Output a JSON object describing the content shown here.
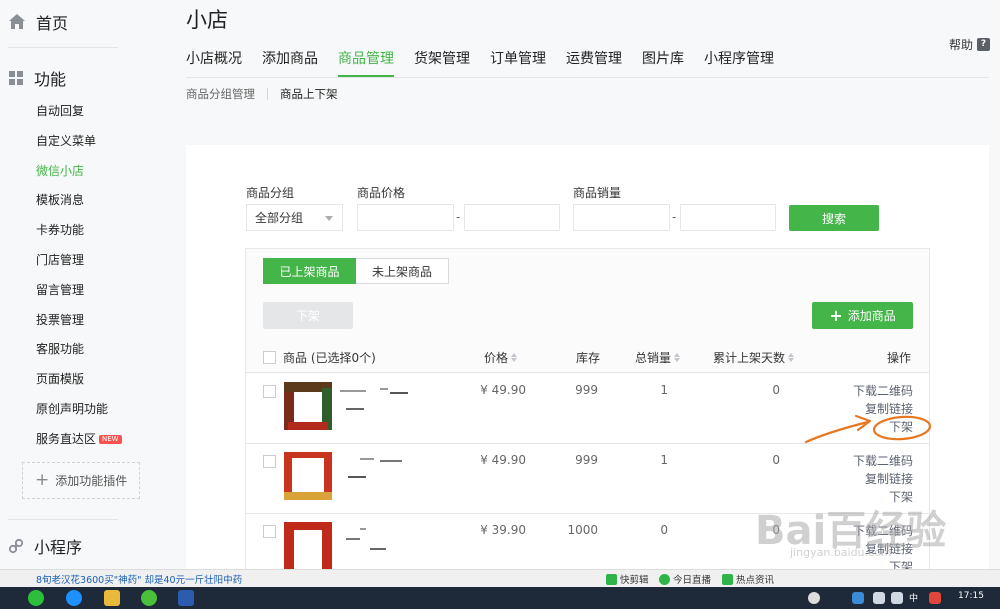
{
  "sidebar": {
    "home": "首页",
    "functions": "功能",
    "items": [
      {
        "label": "自动回复"
      },
      {
        "label": "自定义菜单"
      },
      {
        "label": "微信小店"
      },
      {
        "label": "模板消息"
      },
      {
        "label": "卡券功能"
      },
      {
        "label": "门店管理"
      },
      {
        "label": "留言管理"
      },
      {
        "label": "投票管理"
      },
      {
        "label": "客服功能"
      },
      {
        "label": "页面模版"
      },
      {
        "label": "原创声明功能"
      },
      {
        "label": "服务直达区",
        "badge": "NEW"
      }
    ],
    "add_plugin": "添加功能插件",
    "mini_program": "小程序"
  },
  "header": {
    "title": "小店",
    "help": "帮助",
    "tabs": [
      "小店概况",
      "添加商品",
      "商品管理",
      "货架管理",
      "订单管理",
      "运费管理",
      "图片库",
      "小程序管理"
    ],
    "active_tab": "商品管理",
    "subnav": [
      "商品分组管理",
      "商品上下架"
    ]
  },
  "filters": {
    "group_label": "商品分组",
    "group_value": "全部分组",
    "price_label": "商品价格",
    "sales_label": "商品销量",
    "range_sep": "-",
    "search_button": "搜索"
  },
  "list": {
    "toggle_on": "已上架商品",
    "toggle_off": "未上架商品",
    "offshelf_button": "下架",
    "add_button": "添加商品",
    "columns": {
      "product": "商品 (已选择0个)",
      "price": "价格",
      "stock": "库存",
      "sales": "总销量",
      "days": "累计上架天数",
      "ops": "操作"
    },
    "rows": [
      {
        "price": "¥ 49.90",
        "stock": "999",
        "sales": "1",
        "days": "0",
        "op1": "下载二维码",
        "op2": "复制链接",
        "op3": "下架"
      },
      {
        "price": "¥ 49.90",
        "stock": "999",
        "sales": "1",
        "days": "0",
        "op1": "下载二维码",
        "op2": "复制链接",
        "op3": "下架"
      },
      {
        "price": "¥ 39.90",
        "stock": "1000",
        "sales": "0",
        "days": "0",
        "op1": "下载二维码",
        "op2": "复制链接",
        "op3": "下架"
      }
    ]
  },
  "statusbar": {
    "news": "8旬老汉花3600买\"神药\" 却是40元一斤壮阳中药",
    "item1": "快剪辑",
    "item2": "今日直播",
    "item3": "热点资讯"
  },
  "taskbar": {
    "time": "17:15",
    "ime": "中"
  },
  "watermark": {
    "main": "Bai百经验",
    "sub": "jingyan.baidu.com"
  },
  "colors": {
    "accent": "#44b549",
    "annotation": "#e87722"
  }
}
